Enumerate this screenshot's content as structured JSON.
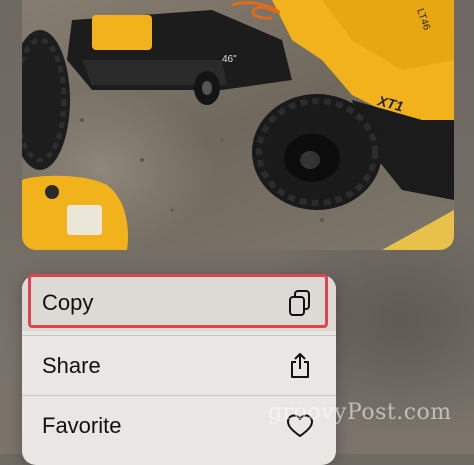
{
  "menu": {
    "items": [
      {
        "label": "Copy",
        "icon": "copy-icon"
      },
      {
        "label": "Share",
        "icon": "share-icon"
      },
      {
        "label": "Favorite",
        "icon": "heart-icon"
      }
    ],
    "highlighted_item": "Copy",
    "highlight_color": "#e0454f"
  },
  "photo": {
    "mower_badge": "46\"",
    "mower_model": "LT46",
    "mower_logo": "XT1"
  },
  "watermark": "groovyPost.com",
  "colors": {
    "menu_background": "#e9e7e3",
    "mower_yellow": "#f2b21c"
  }
}
